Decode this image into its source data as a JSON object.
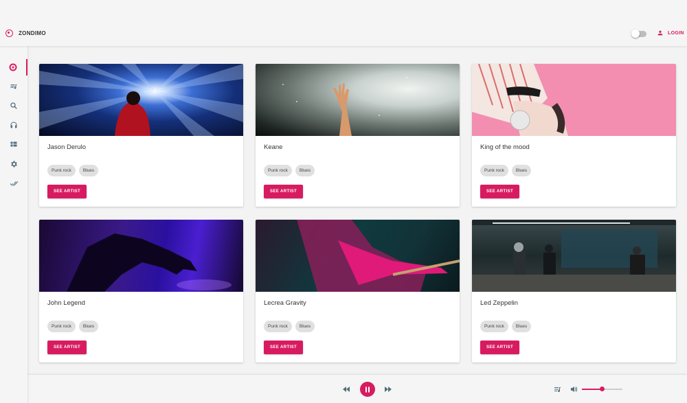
{
  "app": {
    "name": "ZONDIMO"
  },
  "header": {
    "login_label": "LOGIN",
    "dark_mode_on": false
  },
  "sidebar": {
    "items": [
      {
        "icon": "record-icon",
        "active": true
      },
      {
        "icon": "playlist-icon",
        "active": false
      },
      {
        "icon": "search-icon",
        "active": false
      },
      {
        "icon": "headphones-icon",
        "active": false
      },
      {
        "icon": "dashboard-icon",
        "active": false
      },
      {
        "icon": "settings-icon",
        "active": false
      },
      {
        "icon": "done-all-icon",
        "active": false
      }
    ]
  },
  "cards": [
    {
      "title": "Jason Derulo",
      "tags": [
        "Punk rock",
        "Blues"
      ],
      "button": "SEE ARTIST"
    },
    {
      "title": "Keane",
      "tags": [
        "Punk rock",
        "Blues"
      ],
      "button": "SEE ARTIST"
    },
    {
      "title": "King of the mood",
      "tags": [
        "Punk rock",
        "Blues"
      ],
      "button": "SEE ARTIST"
    },
    {
      "title": "John Legend",
      "tags": [
        "Punk rock",
        "Blues"
      ],
      "button": "SEE ARTIST"
    },
    {
      "title": "Lecrea Gravity",
      "tags": [
        "Punk rock",
        "Blues"
      ],
      "button": "SEE ARTIST"
    },
    {
      "title": "Led Zeppelin",
      "tags": [
        "Punk rock",
        "Blues"
      ],
      "button": "SEE ARTIST"
    }
  ],
  "player": {
    "state": "playing",
    "volume": 0.5
  },
  "colors": {
    "accent": "#d81b60",
    "background": "#f3f3f4",
    "icon": "#546e7a"
  }
}
